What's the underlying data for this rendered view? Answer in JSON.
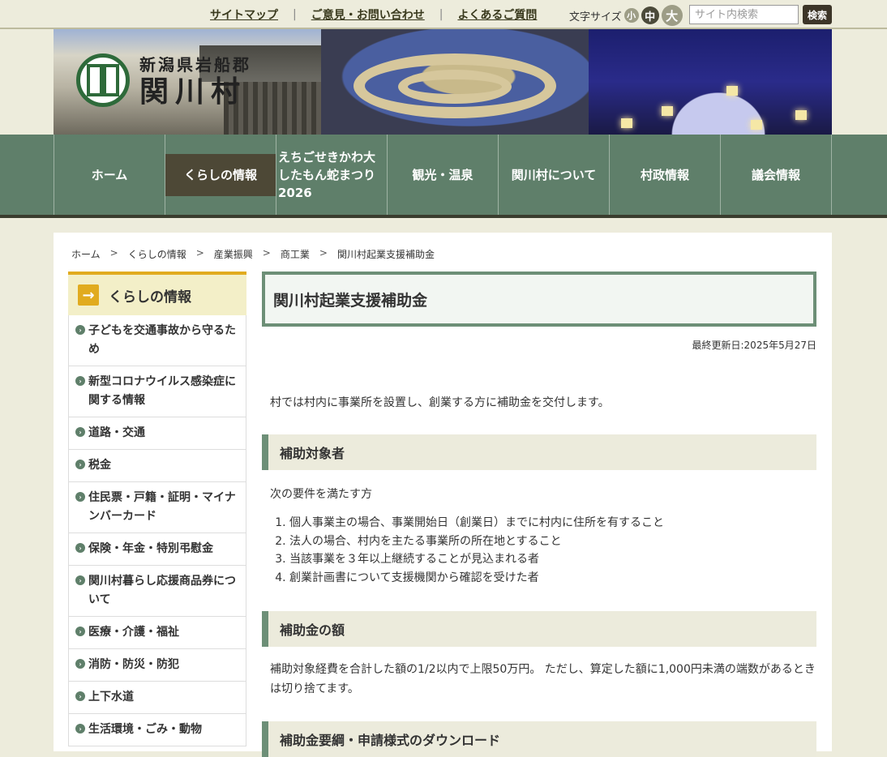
{
  "topbar": {
    "links": [
      "サイトマップ",
      "ご意見・お問い合わせ",
      "よくあるご質問"
    ],
    "separator": "|",
    "fontsize_label": "文字サイズ",
    "fontsize_small": "小",
    "fontsize_medium": "中",
    "fontsize_large": "大",
    "search_placeholder": "サイト内検索",
    "search_button": "検索"
  },
  "header": {
    "logo_pref": "新潟県岩船郡",
    "logo_name": "関川村"
  },
  "gnav": {
    "items": [
      "ホーム",
      "くらしの情報",
      "えちごせきかわ大したもん蛇まつり2026",
      "観光・温泉",
      "関川村について",
      "村政情報",
      "議会情報"
    ]
  },
  "breadcrumb": [
    "ホーム",
    "くらしの情報",
    "産業振興",
    "商工業",
    "関川村起業支援補助金"
  ],
  "breadcrumb_sep": ">",
  "sidebar": {
    "title": "くらしの情報",
    "items": [
      "子どもを交通事故から守るため",
      "新型コロナウイルス感染症に関する情報",
      "道路・交通",
      "税金",
      "住民票・戸籍・証明・マイナンバーカード",
      "保険・年金・特別弔慰金",
      "関川村暮らし応援商品券について",
      "医療・介護・福祉",
      "消防・防災・防犯",
      "上下水道",
      "生活環境・ごみ・動物"
    ]
  },
  "main": {
    "title": "関川村起業支援補助金",
    "updated": "最終更新日:2025年5月27日",
    "lead": "村では村内に事業所を設置し、創業する方に補助金を交付します。",
    "section1": {
      "heading": "補助対象者",
      "intro": "次の要件を満たす方",
      "items": [
        "個人事業主の場合、事業開始日（創業日）までに村内に住所を有すること",
        "法人の場合、村内を主たる事業所の所在地とすること",
        "当該事業を３年以上継続することが見込まれる者",
        "創業計画書について支援機関から確認を受けた者"
      ]
    },
    "section2": {
      "heading": "補助金の額",
      "text": "補助対象経費を合計した額の1/2以内で上限50万円。 ただし、算定した額に1,000円未満の端数があるときは切り捨てます。"
    },
    "section3": {
      "heading": "補助金要綱・申請様式のダウンロード"
    }
  }
}
